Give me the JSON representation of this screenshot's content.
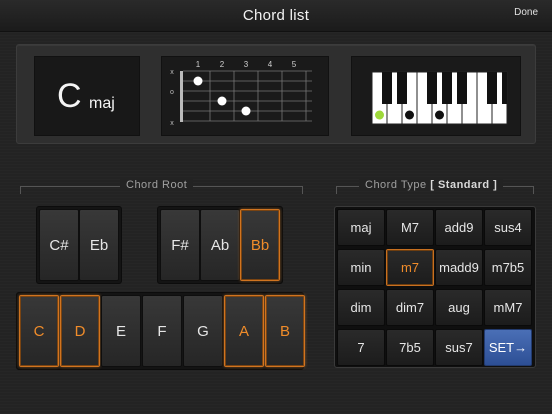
{
  "header": {
    "title": "Chord list",
    "done_label": "Done"
  },
  "display": {
    "chord_root": "C",
    "chord_type": "maj",
    "guitar": {
      "fret_numbers": [
        "1",
        "2",
        "3",
        "4",
        "5"
      ],
      "string_marks": [
        "x",
        "o",
        "",
        "",
        "",
        "x"
      ]
    },
    "piano": {
      "highlight_color": "#9ed93a"
    }
  },
  "chord_root": {
    "label": "Chord Root",
    "sharps_left": [
      {
        "label": "C#",
        "active": false
      },
      {
        "label": "Eb",
        "active": false
      }
    ],
    "sharps_right": [
      {
        "label": "F#",
        "active": false
      },
      {
        "label": "Ab",
        "active": false
      },
      {
        "label": "Bb",
        "active": true
      }
    ],
    "naturals": [
      {
        "label": "C",
        "active": true
      },
      {
        "label": "D",
        "active": true
      },
      {
        "label": "E",
        "active": false
      },
      {
        "label": "F",
        "active": false
      },
      {
        "label": "G",
        "active": false
      },
      {
        "label": "A",
        "active": true
      },
      {
        "label": "B",
        "active": true
      }
    ]
  },
  "chord_type": {
    "label": "Chord Type",
    "mode": "[ Standard ]",
    "rows": [
      [
        "maj",
        "M7",
        "add9",
        "sus4"
      ],
      [
        "min",
        "m7",
        "madd9",
        "m7b5"
      ],
      [
        "dim",
        "dim7",
        "aug",
        "mM7"
      ],
      [
        "7",
        "7b5",
        "sus7",
        "SET→"
      ]
    ],
    "selected": "m7",
    "set_label": "SET→"
  },
  "colors": {
    "accent": "#f08c2a",
    "set_button": "#3a5ea6",
    "note_highlight": "#9ed93a"
  }
}
